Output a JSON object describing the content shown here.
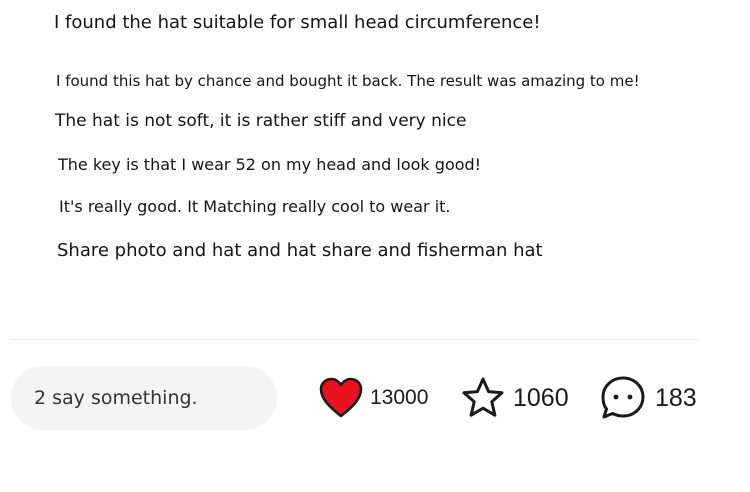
{
  "review": {
    "lines": [
      "I found the hat suitable for small head circumference!",
      "I found this hat by chance and bought it back. The result was amazing to me!",
      "The hat is not soft, it is rather stiff and very nice",
      "The key is that I wear 52 on my head and look good!",
      "It's really good. It Matching really cool to wear it.",
      "Share photo and hat and hat share and fisherman hat"
    ]
  },
  "bottom_bar": {
    "comment_placeholder": "2 say something.",
    "like": {
      "icon": "heart-icon",
      "count": "13000",
      "color": "#e8121f"
    },
    "favorite": {
      "icon": "star-icon",
      "count": "1060"
    },
    "comments": {
      "icon": "chat-bubble-icon",
      "count": "183"
    }
  }
}
